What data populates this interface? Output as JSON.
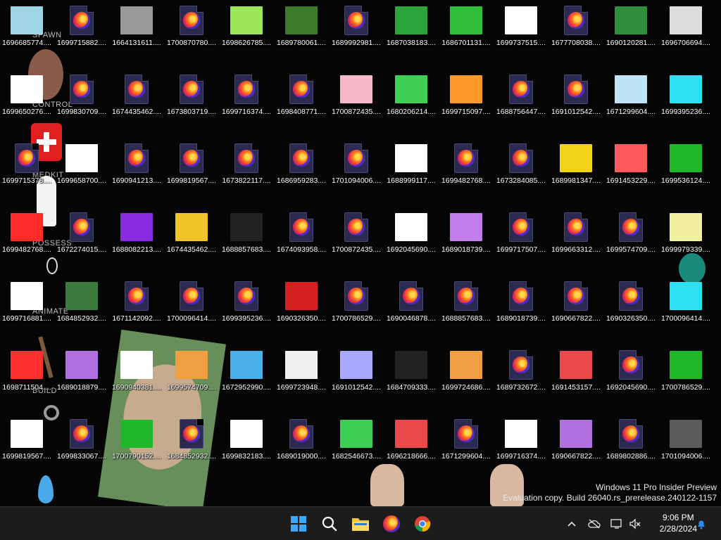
{
  "wallpaper": {
    "labels": [
      "SPAWN",
      "CONTROL",
      "MEDKIT",
      "POSSESS",
      "ANIMATE",
      "BUILD"
    ]
  },
  "colors": {
    "taskbar": "#1c1c1c",
    "desktop": "#050505",
    "accent": "#0a84ff"
  },
  "desktop_icons": [
    [
      {
        "label": "1696685774....",
        "kind": "image",
        "color": "#9fd3e6"
      },
      {
        "label": "1699715882....",
        "kind": "firefox"
      },
      {
        "label": "1664131611....",
        "kind": "image",
        "color": "#9a9a9a"
      },
      {
        "label": "1700870780....",
        "kind": "firefox"
      },
      {
        "label": "1698626785....",
        "kind": "image",
        "color": "#9de85a"
      },
      {
        "label": "1689780061....",
        "kind": "image",
        "color": "#3a7a2a"
      },
      {
        "label": "1689992981....",
        "kind": "firefox"
      },
      {
        "label": "1687038183....",
        "kind": "image",
        "color": "#2aa63a"
      },
      {
        "label": "1686701131....",
        "kind": "image",
        "color": "#2fbf3a"
      },
      {
        "label": "1699737515....",
        "kind": "image",
        "color": "#ffffff"
      },
      {
        "label": "1677708038....",
        "kind": "firefox"
      },
      {
        "label": "1690120281....",
        "kind": "image",
        "color": "#2f8f3a"
      },
      {
        "label": "1696706694....",
        "kind": "image",
        "color": "#dddddd"
      }
    ],
    [
      {
        "label": "1699650276....",
        "kind": "image",
        "color": "#ffffff"
      },
      {
        "label": "1699830709....",
        "kind": "firefox"
      },
      {
        "label": "1674435462....",
        "kind": "firefox"
      },
      {
        "label": "1673803719....",
        "kind": "firefox"
      },
      {
        "label": "1699716374....",
        "kind": "firefox"
      },
      {
        "label": "1698408771....",
        "kind": "firefox"
      },
      {
        "label": "1700872435....",
        "kind": "image",
        "color": "#f4b8c8"
      },
      {
        "label": "1680206214....",
        "kind": "image",
        "color": "#3fcf55"
      },
      {
        "label": "1699715097....",
        "kind": "image",
        "color": "#ff9a2a"
      },
      {
        "label": "1688756447....",
        "kind": "firefox"
      },
      {
        "label": "1691012542....",
        "kind": "firefox"
      },
      {
        "label": "1671299604....",
        "kind": "image",
        "color": "#bde4f7"
      },
      {
        "label": "1699395236....",
        "kind": "image",
        "color": "#2ee0f0"
      }
    ],
    [
      {
        "label": "1699715378....",
        "kind": "firefox"
      },
      {
        "label": "1699658700....",
        "kind": "image",
        "color": "#ffffff"
      },
      {
        "label": "1690941213....",
        "kind": "firefox"
      },
      {
        "label": "1699819567....",
        "kind": "firefox"
      },
      {
        "label": "1673822117....",
        "kind": "firefox"
      },
      {
        "label": "1686959283....",
        "kind": "firefox"
      },
      {
        "label": "1701094006....",
        "kind": "firefox"
      },
      {
        "label": "1688999117....",
        "kind": "image",
        "color": "#ffffff"
      },
      {
        "label": "1699482768....",
        "kind": "firefox"
      },
      {
        "label": "1673284085....",
        "kind": "firefox"
      },
      {
        "label": "1689981347....",
        "kind": "image",
        "color": "#f2d21a"
      },
      {
        "label": "1691453229....",
        "kind": "image",
        "color": "#ff5a5a"
      },
      {
        "label": "1699536124....",
        "kind": "image",
        "color": "#1fb82a"
      }
    ],
    [
      {
        "label": "1699482768....",
        "kind": "image",
        "color": "#ff2a2a"
      },
      {
        "label": "1672274015....",
        "kind": "firefox"
      },
      {
        "label": "1688082213....",
        "kind": "image",
        "color": "#8a2be2"
      },
      {
        "label": "1674435462....",
        "kind": "image",
        "color": "#f2c22a"
      },
      {
        "label": "1688857683....",
        "kind": "image",
        "color": "#222222"
      },
      {
        "label": "1674093958....",
        "kind": "firefox"
      },
      {
        "label": "1700872435....",
        "kind": "firefox"
      },
      {
        "label": "1692045690....",
        "kind": "image",
        "color": "#ffffff"
      },
      {
        "label": "1689018739....",
        "kind": "image",
        "color": "#c27ee8"
      },
      {
        "label": "1699717507....",
        "kind": "firefox"
      },
      {
        "label": "1699663312....",
        "kind": "firefox"
      },
      {
        "label": "1699574709....",
        "kind": "firefox"
      },
      {
        "label": "1699979339....",
        "kind": "image",
        "color": "#f0f0a0"
      }
    ],
    [
      {
        "label": "1699716881....",
        "kind": "image",
        "color": "#ffffff"
      },
      {
        "label": "1684852932....",
        "kind": "image",
        "color": "#3a7a3a"
      },
      {
        "label": "1671142092....",
        "kind": "firefox"
      },
      {
        "label": "1700096414....",
        "kind": "firefox"
      },
      {
        "label": "1699395236....",
        "kind": "firefox"
      },
      {
        "label": "1690326350....",
        "kind": "image",
        "color": "#d42020"
      },
      {
        "label": "1700786529....",
        "kind": "firefox"
      },
      {
        "label": "1690046878....",
        "kind": "firefox"
      },
      {
        "label": "1688857683....",
        "kind": "firefox"
      },
      {
        "label": "1689018739....",
        "kind": "firefox"
      },
      {
        "label": "1690667822....",
        "kind": "firefox"
      },
      {
        "label": "1690326350....",
        "kind": "firefox"
      },
      {
        "label": "1700096414....",
        "kind": "image",
        "color": "#2ee0f0"
      }
    ],
    [
      {
        "label": "1698711504....",
        "kind": "image",
        "color": "#ff3030"
      },
      {
        "label": "1689018879....",
        "kind": "image",
        "color": "#b070e0"
      },
      {
        "label": "1690940381....",
        "kind": "image",
        "color": "#ffffff"
      },
      {
        "label": "1699574709....",
        "kind": "image",
        "color": "#f0a040"
      },
      {
        "label": "1672952990....",
        "kind": "image",
        "color": "#4ab0e8"
      },
      {
        "label": "1699723948....",
        "kind": "image",
        "color": "#f0f0f0"
      },
      {
        "label": "1691012542....",
        "kind": "image",
        "color": "#a8a8ff"
      },
      {
        "label": "1684709333....",
        "kind": "image",
        "color": "#222222"
      },
      {
        "label": "1699724686....",
        "kind": "image",
        "color": "#f0a040"
      },
      {
        "label": "1689732672....",
        "kind": "firefox"
      },
      {
        "label": "1691453157....",
        "kind": "image",
        "color": "#e84a4a"
      },
      {
        "label": "1692045690....",
        "kind": "firefox"
      },
      {
        "label": "1700786529....",
        "kind": "image",
        "color": "#1fb82a"
      }
    ],
    [
      {
        "label": "1699819567....",
        "kind": "image",
        "color": "#ffffff"
      },
      {
        "label": "1699833067....",
        "kind": "firefox"
      },
      {
        "label": "1700790152....",
        "kind": "image",
        "color": "#1fb82a"
      },
      {
        "label": "1684852932....",
        "kind": "firefox"
      },
      {
        "label": "1699832183....",
        "kind": "image",
        "color": "#ffffff"
      },
      {
        "label": "1689019000....",
        "kind": "firefox"
      },
      {
        "label": "1682546673....",
        "kind": "image",
        "color": "#3fcf55"
      },
      {
        "label": "1696218666....",
        "kind": "image",
        "color": "#e84a4a"
      },
      {
        "label": "1671299604....",
        "kind": "firefox"
      },
      {
        "label": "1699716374....",
        "kind": "image",
        "color": "#ffffff"
      },
      {
        "label": "1690667822....",
        "kind": "image",
        "color": "#b070e0"
      },
      {
        "label": "1689802886....",
        "kind": "firefox"
      },
      {
        "label": "1701094006....",
        "kind": "image",
        "color": "#5a5a5a"
      }
    ]
  ],
  "watermark": {
    "line1": "Windows 11 Pro Insider Preview",
    "line2": "Evaluation copy. Build 26040.rs_prerelease.240122-1157"
  },
  "taskbar": {
    "apps": [
      {
        "name": "start-button",
        "icon": "windows-logo-icon"
      },
      {
        "name": "search-button",
        "icon": "search-icon"
      },
      {
        "name": "file-explorer-button",
        "icon": "folder-icon"
      },
      {
        "name": "firefox-button",
        "icon": "firefox-icon"
      },
      {
        "name": "chrome-button",
        "icon": "chrome-icon"
      }
    ],
    "clock": {
      "time": "9:06 PM",
      "date": "2/28/2024"
    }
  }
}
